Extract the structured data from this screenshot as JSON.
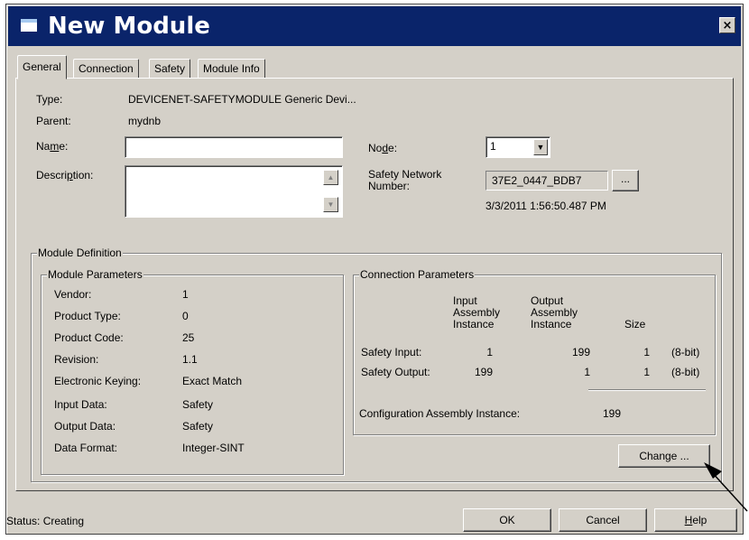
{
  "window": {
    "title": "New Module",
    "close_label": "×"
  },
  "tabs": [
    {
      "label": "General",
      "active": true
    },
    {
      "label": "Connection",
      "active": false
    },
    {
      "label": "Safety",
      "active": false
    },
    {
      "label": "Module Info",
      "active": false
    }
  ],
  "general": {
    "type_label": "Type:",
    "type_value": "DEVICENET-SAFETYMODULE Generic Devi...",
    "parent_label": "Parent:",
    "parent_value": "mydnb",
    "name_label_pre": "Na",
    "name_label_u": "m",
    "name_label_post": "e:",
    "name_value": "",
    "description_label_pre": "Descri",
    "description_label_u": "p",
    "description_label_post": "tion:",
    "description_value": "",
    "node_label_pre": "No",
    "node_label_u": "d",
    "node_label_post": "e:",
    "node_value": "1",
    "snn_label_line1": "Safety Network",
    "snn_label_line2_pre": "Number:",
    "snn_label_line2_mid_pre": "Safety Netwo",
    "snn_label_u": "r",
    "snn_label_post": "k",
    "snn_value": "37E2_0447_BDB7",
    "snn_button_label": "...",
    "snn_timestamp": "3/3/2011 1:56:50.487 PM"
  },
  "module_definition": {
    "title": "Module Definition",
    "parameters": {
      "title": "Module Parameters",
      "rows": [
        {
          "label": "Vendor:",
          "value": "1"
        },
        {
          "label": "Product Type:",
          "value": "0"
        },
        {
          "label": "Product Code:",
          "value": "25"
        },
        {
          "label": "Revision:",
          "value": "1.1"
        },
        {
          "label": "Electronic Keying:",
          "value": "Exact Match"
        },
        {
          "label": "Input Data:",
          "value": "Safety"
        },
        {
          "label": "Output Data:",
          "value": "Safety"
        },
        {
          "label": "Data Format:",
          "value": "Integer-SINT"
        }
      ]
    },
    "connection": {
      "title": "Connection Parameters",
      "headers": {
        "input": "Input\nAssembly\nInstance",
        "output": "Output\nAssembly\nInstance",
        "size": "Size"
      },
      "rows": [
        {
          "label": "Safety Input:",
          "input": "1",
          "output": "199",
          "size": "1",
          "bits": "(8-bit)"
        },
        {
          "label": "Safety Output:",
          "input": "199",
          "output": "1",
          "size": "1",
          "bits": "(8-bit)"
        }
      ],
      "config_label": "Configuration Assembly Instance:",
      "config_value": "199"
    },
    "change_button": "Change ..."
  },
  "footer": {
    "status": "Status:  Creating",
    "ok": "OK",
    "cancel": "Cancel",
    "help_u": "H",
    "help_rest": "elp"
  }
}
